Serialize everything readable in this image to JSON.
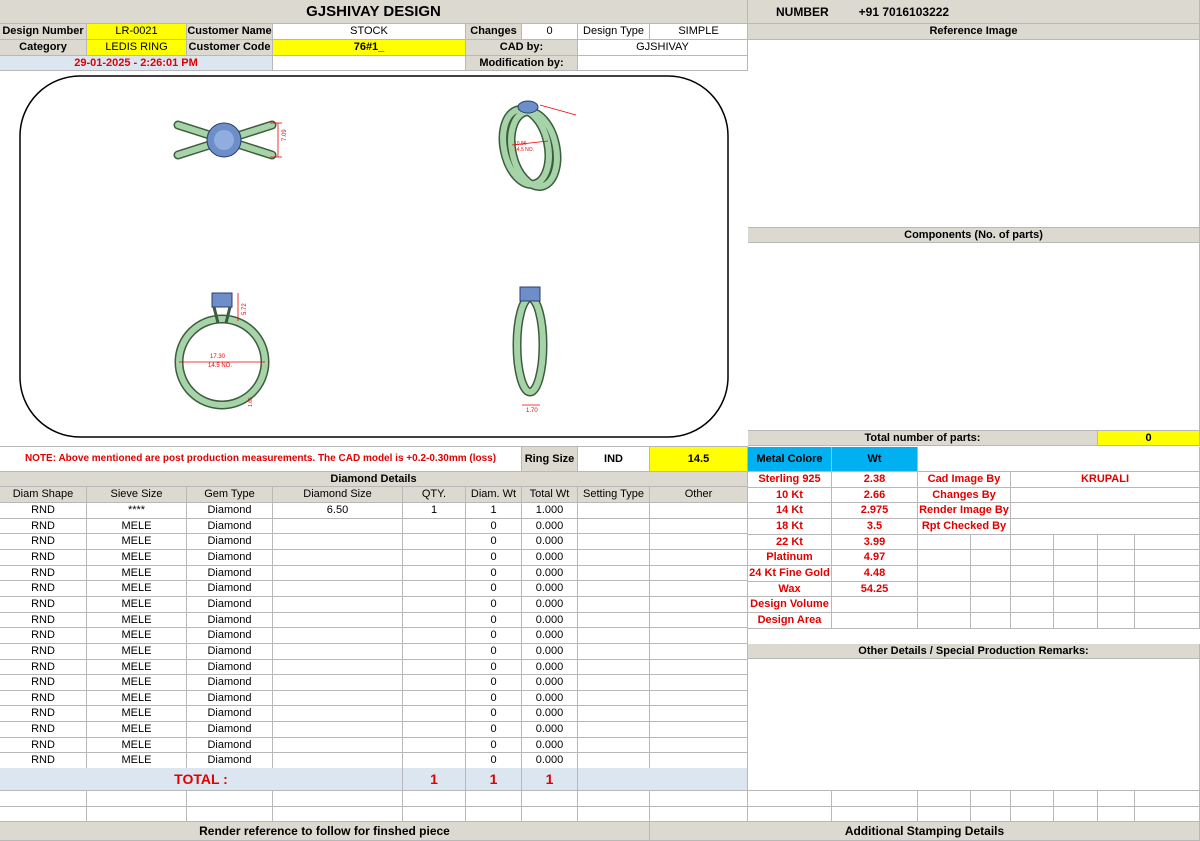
{
  "title": "GJSHIVAY DESIGN",
  "number": {
    "label": "NUMBER",
    "value": "+91 7016103222"
  },
  "info": {
    "design_number_label": "Design Number",
    "design_number": "LR-0021",
    "customer_name_label": "Customer Name",
    "customer_name": "STOCK",
    "changes_label": "Changes",
    "changes": "0",
    "design_type_label": "Design Type",
    "design_type": "SIMPLE",
    "category_label": "Category",
    "category": "LEDIS RING",
    "customer_code_label": "Customer Code",
    "customer_code": "76#1_",
    "cad_by_label": "CAD by:",
    "cad_by": "GJSHIVAY",
    "date": "29-01-2025 - 2:26:01 PM",
    "modification_label": "Modification by:",
    "modification": ""
  },
  "reference_image_label": "Reference Image",
  "components_label": "Components (No. of parts)",
  "total_parts_label": "Total number of parts:",
  "total_parts": "0",
  "note": "NOTE: Above mentioned are post production measurements. The CAD model is +0.2-0.30mm (loss)",
  "ring_size": {
    "label": "Ring Size",
    "standard": "IND",
    "value": "14.5"
  },
  "cad_dims": {
    "top_h": "7.09",
    "side_a": "10.86",
    "side_b": "14.5 NO.",
    "front_h": "5.72",
    "front_d": "17.30",
    "front_no": "14.5 NO.",
    "front_b": "1.65",
    "edge_w": "1.70"
  },
  "metal": {
    "header_label": "Metal Colore",
    "header_wt": "Wt",
    "rows": [
      {
        "name": "Sterling 925",
        "wt": "2.38"
      },
      {
        "name": "10 Kt",
        "wt": "2.66"
      },
      {
        "name": "14 Kt",
        "wt": "2.975"
      },
      {
        "name": "18 Kt",
        "wt": "3.5"
      },
      {
        "name": "22 Kt",
        "wt": "3.99"
      },
      {
        "name": "Platinum",
        "wt": "4.97"
      },
      {
        "name": "24 Kt Fine Gold",
        "wt": "4.48"
      },
      {
        "name": "Wax",
        "wt": "54.25"
      },
      {
        "name": "Design Volume",
        "wt": ""
      },
      {
        "name": "Design Area",
        "wt": ""
      }
    ]
  },
  "credits": [
    {
      "label": "Cad Image By",
      "value": "KRUPALI"
    },
    {
      "label": "Changes By",
      "value": ""
    },
    {
      "label": "Render Image By",
      "value": ""
    },
    {
      "label": "Rpt Checked By",
      "value": ""
    }
  ],
  "diamond": {
    "section_label": "Diamond Details",
    "headers": [
      "Diam Shape",
      "Sieve Size",
      "Gem Type",
      "Diamond Size",
      "QTY.",
      "Diam. Wt",
      "Total Wt",
      "Setting Type",
      "Other"
    ],
    "rows": [
      [
        "RND",
        "****",
        "Diamond",
        "6.50",
        "1",
        "1",
        "1.000",
        "",
        ""
      ],
      [
        "RND",
        "MELE",
        "Diamond",
        "",
        "",
        "0",
        "0.000",
        "",
        ""
      ],
      [
        "RND",
        "MELE",
        "Diamond",
        "",
        "",
        "0",
        "0.000",
        "",
        ""
      ],
      [
        "RND",
        "MELE",
        "Diamond",
        "",
        "",
        "0",
        "0.000",
        "",
        ""
      ],
      [
        "RND",
        "MELE",
        "Diamond",
        "",
        "",
        "0",
        "0.000",
        "",
        ""
      ],
      [
        "RND",
        "MELE",
        "Diamond",
        "",
        "",
        "0",
        "0.000",
        "",
        ""
      ],
      [
        "RND",
        "MELE",
        "Diamond",
        "",
        "",
        "0",
        "0.000",
        "",
        ""
      ],
      [
        "RND",
        "MELE",
        "Diamond",
        "",
        "",
        "0",
        "0.000",
        "",
        ""
      ],
      [
        "RND",
        "MELE",
        "Diamond",
        "",
        "",
        "0",
        "0.000",
        "",
        ""
      ],
      [
        "RND",
        "MELE",
        "Diamond",
        "",
        "",
        "0",
        "0.000",
        "",
        ""
      ],
      [
        "RND",
        "MELE",
        "Diamond",
        "",
        "",
        "0",
        "0.000",
        "",
        ""
      ],
      [
        "RND",
        "MELE",
        "Diamond",
        "",
        "",
        "0",
        "0.000",
        "",
        ""
      ],
      [
        "RND",
        "MELE",
        "Diamond",
        "",
        "",
        "0",
        "0.000",
        "",
        ""
      ],
      [
        "RND",
        "MELE",
        "Diamond",
        "",
        "",
        "0",
        "0.000",
        "",
        ""
      ],
      [
        "RND",
        "MELE",
        "Diamond",
        "",
        "",
        "0",
        "0.000",
        "",
        ""
      ],
      [
        "RND",
        "MELE",
        "Diamond",
        "",
        "",
        "0",
        "0.000",
        "",
        ""
      ],
      [
        "RND",
        "MELE",
        "Diamond",
        "",
        "",
        "0",
        "0.000",
        "",
        ""
      ]
    ],
    "total_label": "TOTAL :",
    "total_qty": "1",
    "total_diam_wt": "1",
    "total_wt": "1"
  },
  "other_details_label": "Other Details / Special Production Remarks:",
  "render_ref_label": "Render reference to follow for finshed piece",
  "stamping_label": "Additional Stamping Details"
}
